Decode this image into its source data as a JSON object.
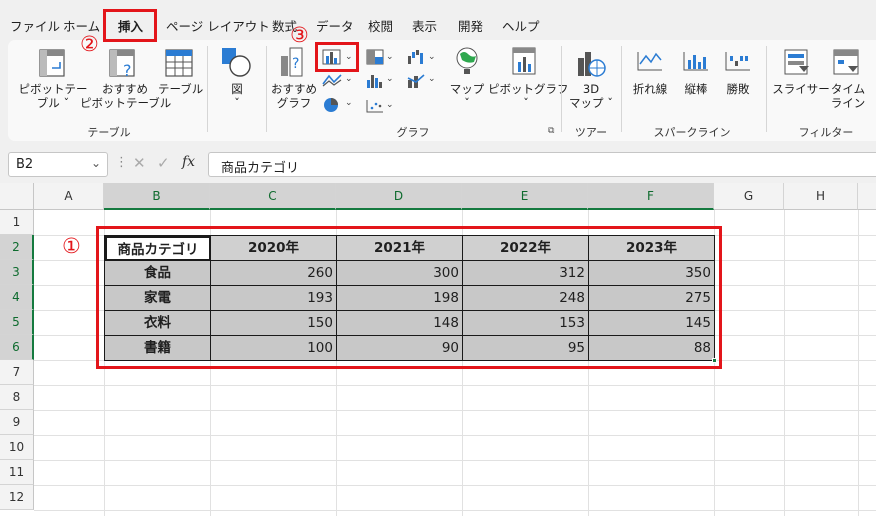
{
  "menu": {
    "tabs": [
      "ファイル",
      "ホーム",
      "挿入",
      "ページ レイアウト",
      "数式",
      "データ",
      "校閲",
      "表示",
      "開発",
      "ヘルプ"
    ],
    "active": "挿入"
  },
  "annotations": {
    "one": "①",
    "two": "②",
    "three": "③"
  },
  "ribbon": {
    "tables": {
      "pivot": "ピボットテー\nブル ˇ",
      "recommended_pivot": "おすすめ\nピボットテーブル",
      "table": "テーブル",
      "group": "テーブル"
    },
    "illustrations": {
      "label": "図\nˇ"
    },
    "charts": {
      "recommended": "おすすめ\nグラフ",
      "maps": "マップ\nˇ",
      "pivot_chart": "ピボットグラフ\nˇ",
      "group": "グラフ"
    },
    "tours": {
      "map3d": "3D\nマップ ˇ",
      "group": "ツアー"
    },
    "sparklines": {
      "line": "折れ線",
      "column": "縦棒",
      "winloss": "勝敗",
      "group": "スパークライン"
    },
    "filters": {
      "slicer": "スライサー",
      "timeline": "タイム\nライン",
      "group": "フィルター"
    }
  },
  "formula_bar": {
    "name_box": "B2",
    "fx": "fx",
    "content": "商品カテゴリ"
  },
  "sheet": {
    "columns": [
      "A",
      "B",
      "C",
      "D",
      "E",
      "F",
      "G",
      "H"
    ],
    "rows": [
      "1",
      "2",
      "3",
      "4",
      "5",
      "6",
      "7",
      "8",
      "9",
      "10",
      "11",
      "12"
    ],
    "table": {
      "header": [
        "商品カテゴリ",
        "2020年",
        "2021年",
        "2022年",
        "2023年"
      ],
      "rows": [
        {
          "label": "食品",
          "values": [
            "260",
            "300",
            "312",
            "350"
          ]
        },
        {
          "label": "家電",
          "values": [
            "193",
            "198",
            "248",
            "275"
          ]
        },
        {
          "label": "衣料",
          "values": [
            "150",
            "148",
            "153",
            "145"
          ]
        },
        {
          "label": "書籍",
          "values": [
            "100",
            "90",
            "95",
            "88"
          ]
        }
      ]
    }
  },
  "colors": {
    "accent_red": "#e3151a",
    "excel_green": "#157a3f"
  }
}
